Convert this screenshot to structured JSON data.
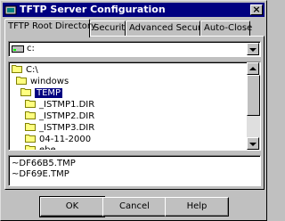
{
  "window": {
    "title": "TFTP Server Configuration"
  },
  "tabs": [
    "TFTP Root Directory",
    "Security",
    "Advanced Security",
    "Auto-Close"
  ],
  "drive": {
    "value": "c:"
  },
  "directories": [
    {
      "label": "C:\\",
      "selected": false
    },
    {
      "label": "windows",
      "selected": false
    },
    {
      "label": "TEMP",
      "selected": true
    },
    {
      "label": "_ISTMP1.DIR",
      "selected": false
    },
    {
      "label": "_ISTMP2.DIR",
      "selected": false
    },
    {
      "label": "_ISTMP3.DIR",
      "selected": false
    },
    {
      "label": "04-11-2000",
      "selected": false
    },
    {
      "label": "ebe",
      "selected": false
    }
  ],
  "files": [
    "~DF66B5.TMP",
    "~DF69E.TMP"
  ],
  "buttons": {
    "ok": "OK",
    "cancel": "Cancel",
    "help": "Help"
  },
  "colors": {
    "titlebar": "#000080",
    "selection": "#000080",
    "face": "#c0c0c0"
  }
}
